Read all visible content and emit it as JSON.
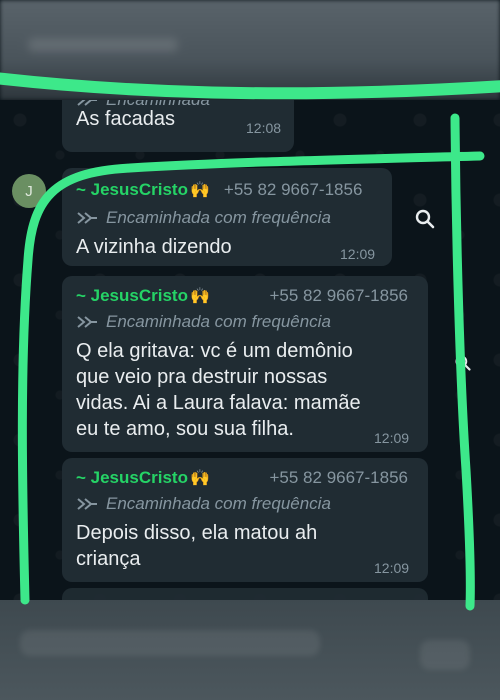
{
  "colors": {
    "bubble": "#202c33",
    "sender_name": "#25d366",
    "muted": "#8696a0",
    "highlight_stroke": "#3de88a"
  },
  "messages": [
    {
      "forwarded_label": "Encaminhada",
      "text": "As facadas",
      "time": "12:08"
    },
    {
      "sender": "~ JesusCristo",
      "sender_emoji": "🙌",
      "phone": "+55 82 9667-1856",
      "forwarded_label": "Encaminhada com frequência",
      "text": "A vizinha dizendo",
      "time": "12:09"
    },
    {
      "sender": "~ JesusCristo",
      "sender_emoji": "🙌",
      "phone": "+55 82 9667-1856",
      "forwarded_label": "Encaminhada com frequência",
      "text": "Q ela gritava: vc é um demônio que veio pra destruir nossas vidas. Ai a Laura falava: mamãe eu te amo, sou sua filha.",
      "time": "12:09"
    },
    {
      "sender": "~ JesusCristo",
      "sender_emoji": "🙌",
      "phone": "+55 82 9667-1856",
      "forwarded_label": "Encaminhada com frequência",
      "text": "Depois disso, ela matou ah criança",
      "time": "12:09"
    }
  ],
  "avatar": {
    "initial": "J"
  },
  "icons": {
    "forward": "forward-arrow-icon",
    "search": "search-icon"
  }
}
